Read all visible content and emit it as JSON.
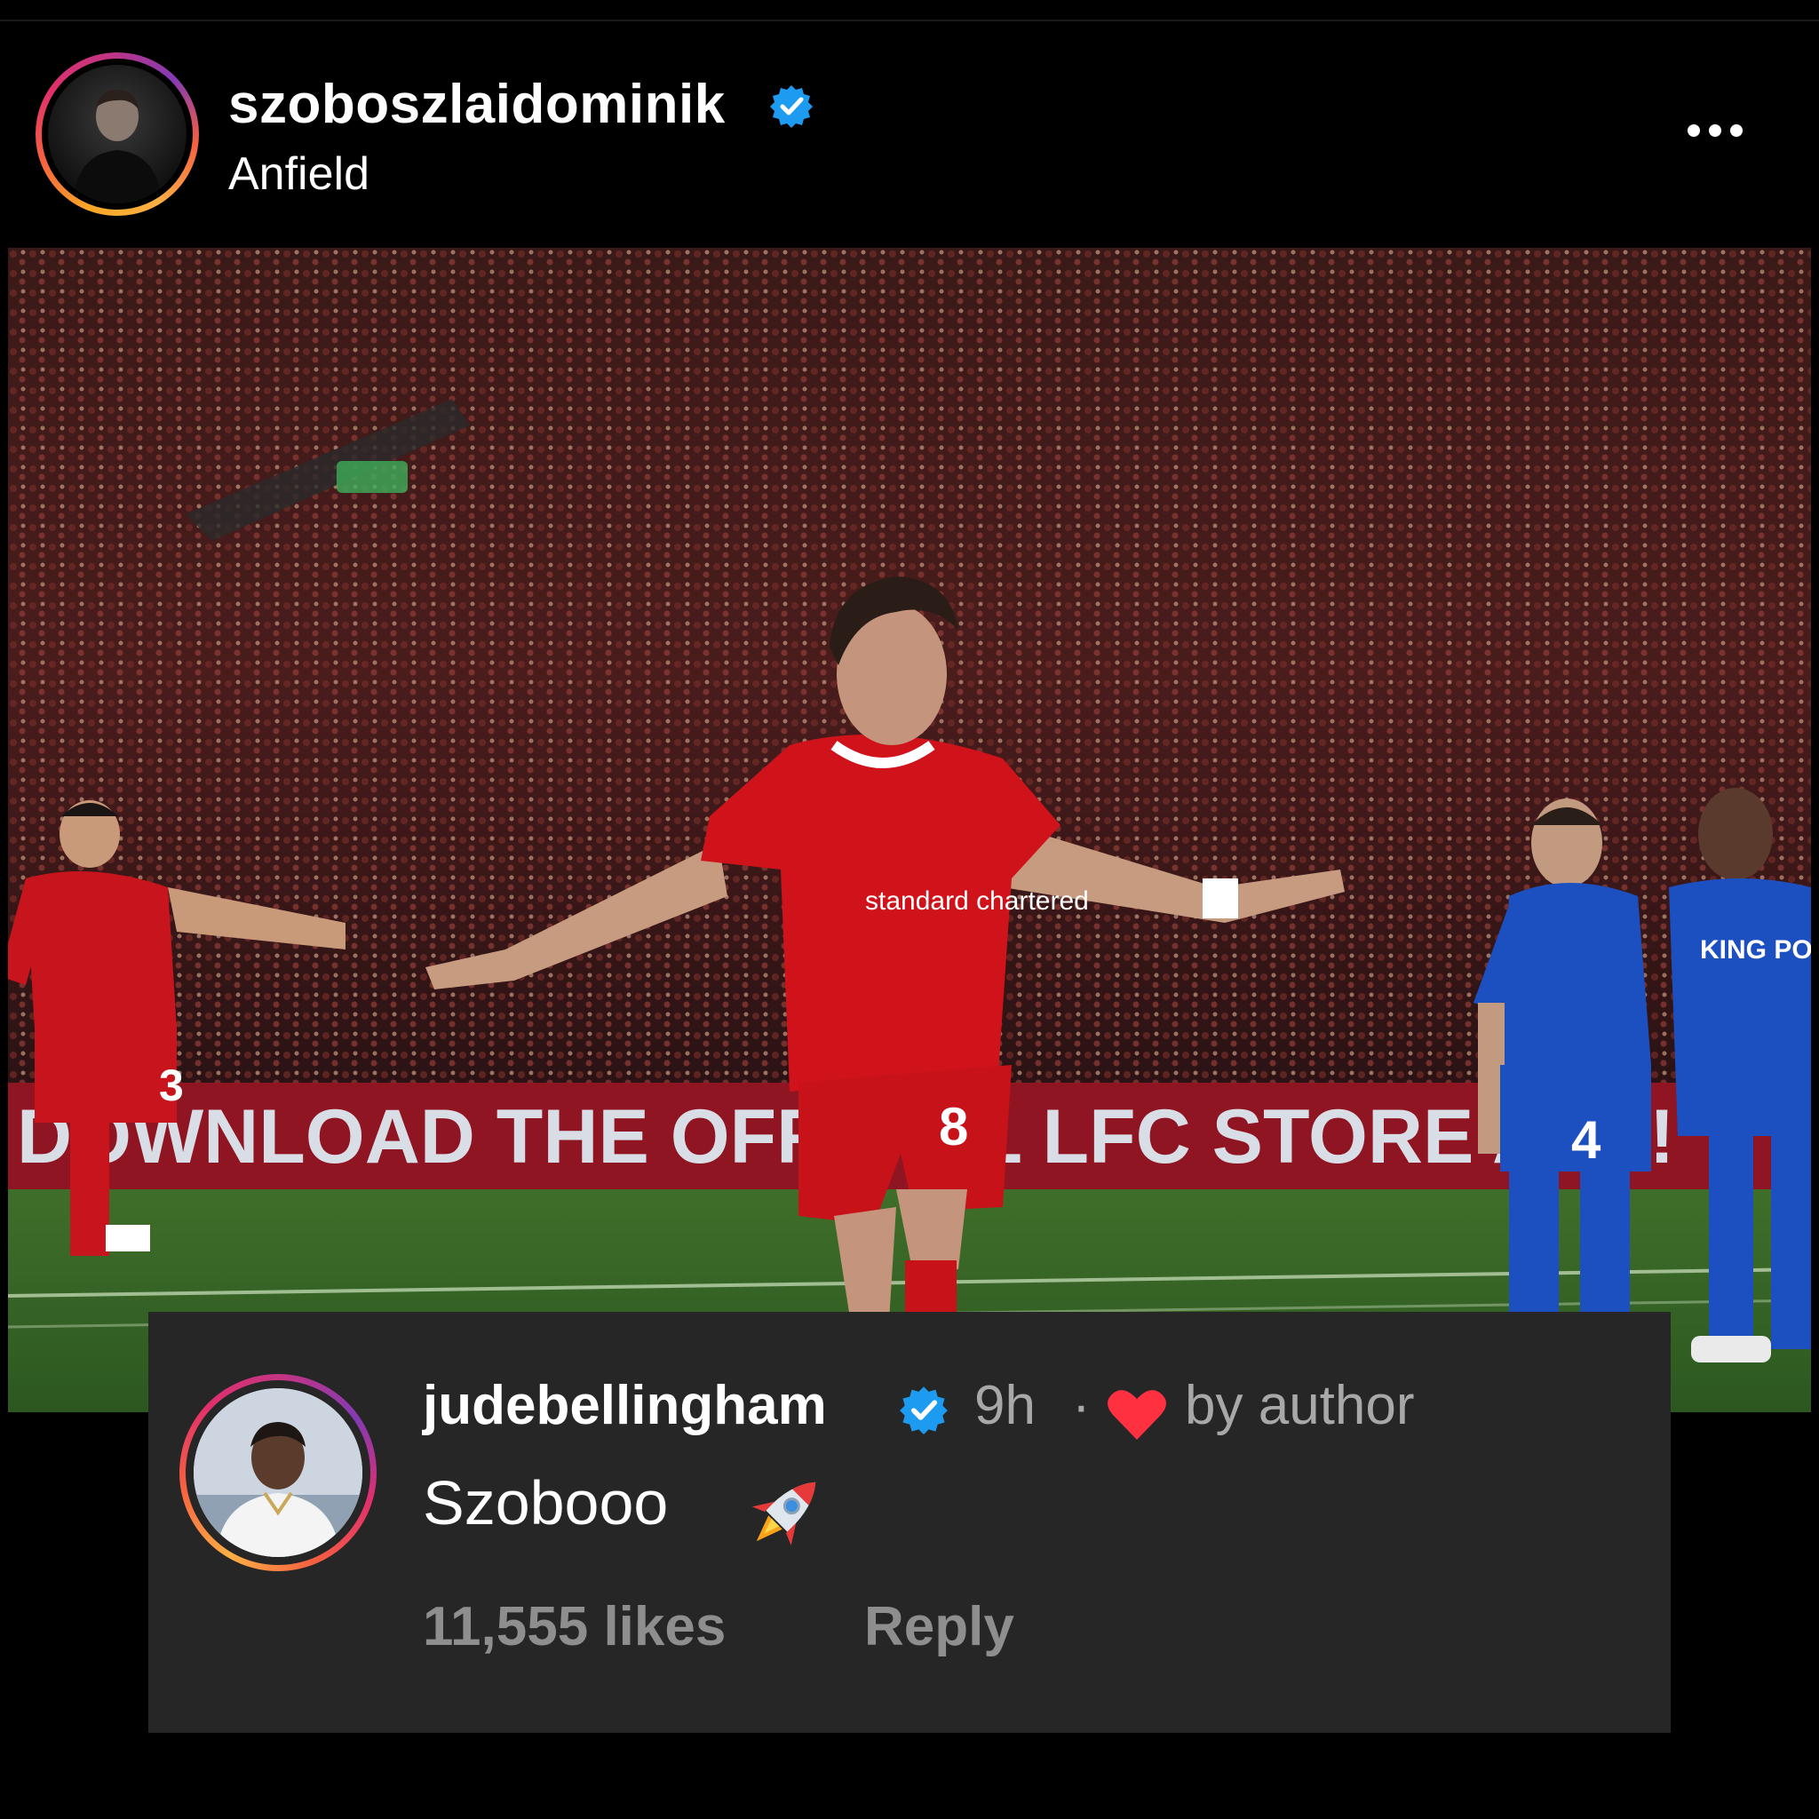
{
  "post": {
    "username": "szoboszlaidominik",
    "verified": true,
    "location": "Anfield",
    "more_icon": "more-horizontal-icon"
  },
  "photo": {
    "banner_text": "DOWNLOAD THE OFFICIAL LFC STORE APP!",
    "shirt_number_main": "8",
    "shirt_number_left": "3",
    "sponsor_text": "standard chartered",
    "opponent_sponsor": "KING POWER",
    "opponent_number": "4"
  },
  "comment": {
    "username": "judebellingham",
    "verified": true,
    "time": "9h",
    "separator": "·",
    "liked_by_author_label": "by author",
    "text": "Szobooo",
    "emoji_icon": "rocket-icon",
    "likes": "11,555 likes",
    "reply_label": "Reply"
  },
  "colors": {
    "verified_blue": "#1d9bf0",
    "heart_red": "#ff3040",
    "comment_bg": "#262626",
    "muted_text": "#a8a8a8",
    "action_text": "#8e8e8e"
  }
}
